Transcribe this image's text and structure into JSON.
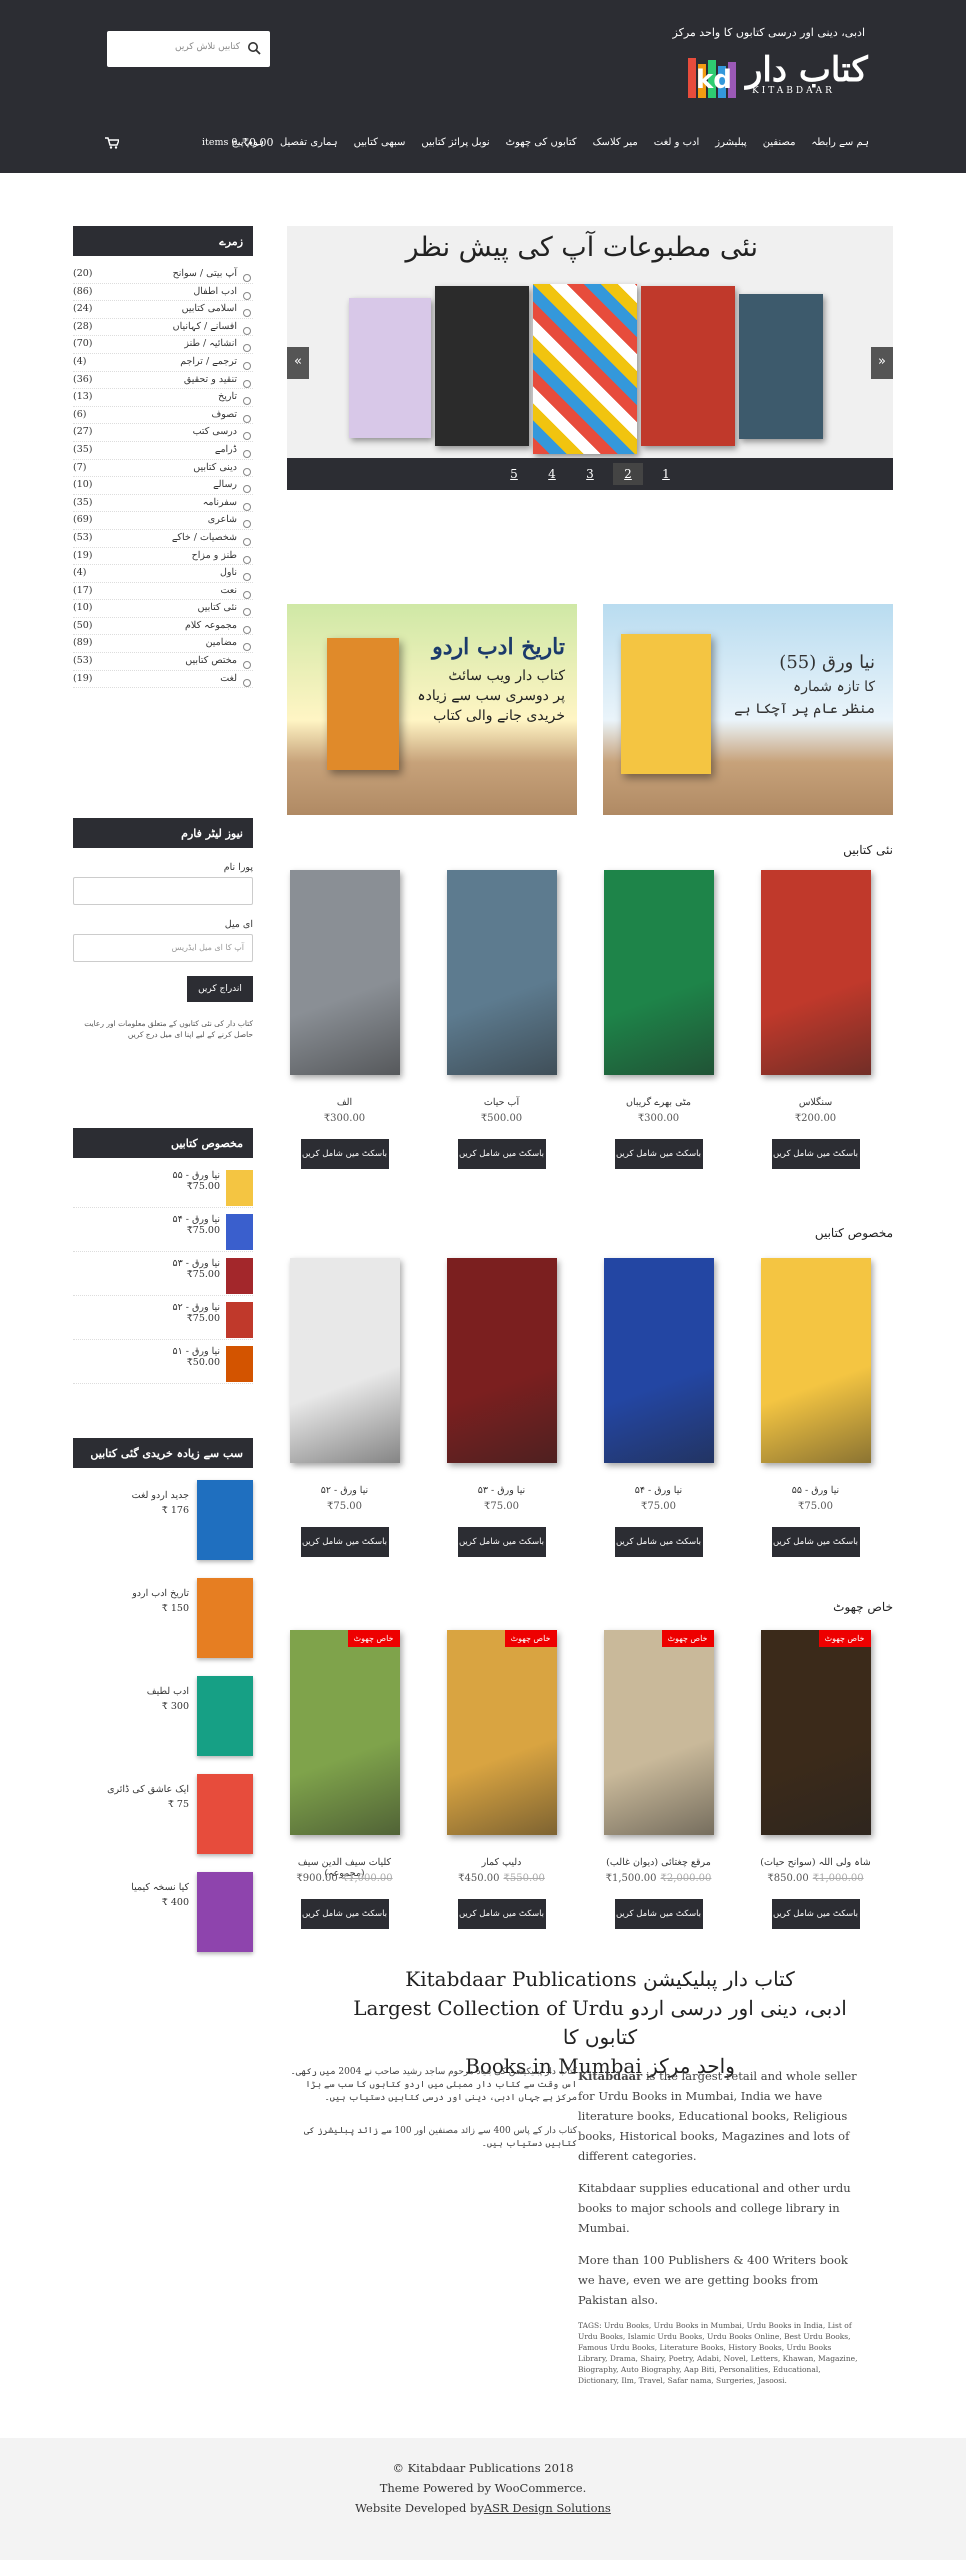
{
  "header": {
    "search_placeholder": "کتابیں تلاش کریں",
    "tagline": "ادبی، دینی اور درسی کتابوں کا واحد مرکز",
    "logo_word": "کتاب دار",
    "logo_latin": "KITABDAAR",
    "cart_items": "items 0",
    "cart_total": "₹0.00",
    "nav": [
      "ہوم پیج",
      "ہماری تفصیل",
      "سبھی کتابیں",
      "نوبل پرائز کتابیں",
      "کتابوں کی چھوٹ",
      "میر کلاسک",
      "ادب و لغت",
      "پبلیشرز",
      "مصنفین",
      "ہم سے رابطہ"
    ]
  },
  "sidebar": {
    "categories_title": "زمرے",
    "categories": [
      {
        "name": "آپ بیتی / سوانح",
        "count": "(20)"
      },
      {
        "name": "ادب اطفال",
        "count": "(86)"
      },
      {
        "name": "اسلامی کتابیں",
        "count": "(24)"
      },
      {
        "name": "افسانے / کہانیاں",
        "count": "(28)"
      },
      {
        "name": "انشائیہ / طنز",
        "count": "(70)"
      },
      {
        "name": "ترجمے / تراجم",
        "count": "(4)"
      },
      {
        "name": "تنقید و تحقیق",
        "count": "(36)"
      },
      {
        "name": "تاریخ",
        "count": "(13)"
      },
      {
        "name": "تصوف",
        "count": "(6)"
      },
      {
        "name": "درسی کتب",
        "count": "(27)"
      },
      {
        "name": "ڈرامے",
        "count": "(35)"
      },
      {
        "name": "دینی کتابیں",
        "count": "(7)"
      },
      {
        "name": "رسالے",
        "count": "(10)"
      },
      {
        "name": "سفرنامہ",
        "count": "(35)"
      },
      {
        "name": "شاعری",
        "count": "(69)"
      },
      {
        "name": "شخصیات / خاکے",
        "count": "(53)"
      },
      {
        "name": "طنز و مزاح",
        "count": "(19)"
      },
      {
        "name": "ناول",
        "count": "(4)"
      },
      {
        "name": "نعت",
        "count": "(17)"
      },
      {
        "name": "نئی کتابیں",
        "count": "(10)"
      },
      {
        "name": "مجموعہ کلام",
        "count": "(50)"
      },
      {
        "name": "مضامین",
        "count": "(89)"
      },
      {
        "name": "مختص کتابیں",
        "count": "(53)"
      },
      {
        "name": "لغت",
        "count": "(19)"
      }
    ],
    "newsletter_title": "نیوز لیٹر فارم",
    "name_label": "پورا نام",
    "email_label": "ای میل",
    "email_placeholder": "آپ کا ای میل ایڈریس",
    "subscribe_label": "اندراج کریں",
    "newsletter_note": "کتاب دار کی نئی کتابوں کے متعلق معلومات اور رعایت حاصل کرنے کے لیے اپنا ای میل درج کریں",
    "featured_title": "مخصوص کتابیں",
    "featured": [
      {
        "name": "نیا ورق - ۵۵",
        "price": "₹75.00",
        "color": "#f4c542"
      },
      {
        "name": "نیا ورق - ۵۴",
        "price": "₹75.00",
        "color": "#3a5fcd"
      },
      {
        "name": "نیا ورق - ۵۳",
        "price": "₹75.00",
        "color": "#a3272b"
      },
      {
        "name": "نیا ورق - ۵۲",
        "price": "₹75.00",
        "color": "#c0392b"
      },
      {
        "name": "نیا ورق - ۵۱",
        "price": "₹50.00",
        "color": "#d35400"
      }
    ],
    "bestseller_title": "سب سے زیادہ خریدی گئی کتابیں",
    "bestsellers": [
      {
        "name": "جدید اردو لغت",
        "price": "176 ₹",
        "color": "#1f6fbf"
      },
      {
        "name": "تاریخ ادب اردو",
        "price": "150 ₹",
        "color": "#e67e22"
      },
      {
        "name": "ادب لطیف",
        "price": "300 ₹",
        "color": "#16a085"
      },
      {
        "name": "ایک عاشق کی ڈائری",
        "price": "75 ₹",
        "color": "#e74c3c"
      },
      {
        "name": "کیا نسخہ کیمیا",
        "price": "400 ₹",
        "color": "#8e44ad"
      }
    ]
  },
  "slider": {
    "title": "نئی مطبوعات آپ کی پیش نظر",
    "prev": "«",
    "next": "»",
    "pages": [
      "5",
      "4",
      "3",
      "2",
      "1"
    ]
  },
  "banners": [
    {
      "line1": "تاریخ ادب اردو",
      "line2": "کتاب دار ویب سائٹ",
      "line3": "پر دوسری سب سے زیادہ",
      "line4": "خریدی جانے والی کتاب"
    },
    {
      "line1": "نیا ورق",
      "line2": "(55)",
      "line3": "کا تازہ شمارہ",
      "line4": "منظر عام پر آچکا ہے"
    }
  ],
  "sections": [
    {
      "title": "نئی کتابیں",
      "products": [
        {
          "name": "سنگلاس",
          "price": "₹200.00",
          "old": "",
          "sale": "",
          "color": "#c0392b"
        },
        {
          "name": "مٹی بھرے گریباں",
          "price": "₹300.00",
          "old": "",
          "sale": "",
          "color": "#1e8449"
        },
        {
          "name": "آب حیات",
          "price": "₹500.00",
          "old": "",
          "sale": "",
          "color": "#5d7b8f"
        },
        {
          "name": "الف",
          "price": "₹300.00",
          "old": "",
          "sale": "",
          "color": "#8a8f95"
        }
      ]
    },
    {
      "title": "مخصوص کتابیں",
      "products": [
        {
          "name": "نیا ورق - ۵۵",
          "price": "₹75.00",
          "old": "",
          "sale": "",
          "color": "#f4c542"
        },
        {
          "name": "نیا ورق - ۵۴",
          "price": "₹75.00",
          "old": "",
          "sale": "",
          "color": "#2346a3"
        },
        {
          "name": "نیا ورق - ۵۳",
          "price": "₹75.00",
          "old": "",
          "sale": "",
          "color": "#7b1f1f"
        },
        {
          "name": "نیا ورق - ۵۲",
          "price": "₹75.00",
          "old": "",
          "sale": "",
          "color": "#e8e8e8"
        }
      ]
    },
    {
      "title": "خاص چھوٹ",
      "products": [
        {
          "name": "شاہ ولی اللہ (سوانح حیات)",
          "price": "₹850.00",
          "old": "₹1,000.00",
          "sale": "خاص چھوٹ",
          "color": "#3b2a1a"
        },
        {
          "name": "مرقع چغتائی (دیوان غالب)",
          "price": "₹1,500.00",
          "old": "₹2,000.00",
          "sale": "خاص چھوٹ",
          "color": "#c9b99a"
        },
        {
          "name": "دلیپ کمار",
          "price": "₹450.00",
          "old": "₹550.00",
          "sale": "خاص چھوٹ",
          "color": "#d9a441"
        },
        {
          "name": "کلیات سیف الدین سیف (مجموعہ)",
          "price": "₹900.00",
          "old": "₹1,000.00",
          "sale": "خاص چھوٹ",
          "color": "#7fa34b"
        }
      ]
    }
  ],
  "add_to_cart": "باسکٹ میں شامل کریں",
  "about": {
    "heading_lines": [
      "Kitabdaar Publications کتاب دار پبلیکیشن",
      "Largest Collection of Urdu ادبی، دینی اور درسی اردو کتابوں کا",
      "Books in Mumbai واحد مرکز"
    ],
    "brand": "Kitabdaar",
    "en_p1": " is the largest retail and whole seller for Urdu Books in Mumbai, India we have literature books, Educational books, Religious books, Historical books, Magazines and lots of different categories.",
    "en_p2": "Kitabdaar supplies educational and other urdu books to major schools and college library in Mumbai.",
    "en_p3": "More than 100 Publishers & 400 Writers book we have, even we are getting books from Pakistan also.",
    "tags": "TAGS: Urdu Books, Urdu Books in Mumbai, Urdu Books in India, List of Urdu Books, Islamic Urdu Books, Urdu Books Online, Best Urdu Books, Famous Urdu Books, Literature Books, History Books, Urdu Books Library, Drama, Shairy, Poetry, Adabi, Novel, Letters, Khawan, Magazine, Biography, Auto Biography, Aap Biti, Personalities, Educational, Dictionary, Ilm, Travel, Safar nama, Surgeries, Jasoosi.",
    "ur_p1": "کتاب دار پبلیکیشن کی بنیاد مرحوم ساجد رشید صاحب نے 2004 میں رکھی۔ اس وقت سے کتاب دار ممبئی میں اردو کتابوں کا سب سے بڑا مرکز ہے جہاں ادبی، دینی اور درسی کتابیں دستیاب ہیں۔",
    "ur_p2": "کتاب دار کے پاس 400 سے زائد مصنفین اور 100 سے زائد پبلیشرز کی کتابیں دستیاب ہیں۔"
  },
  "footer": {
    "copyright": "© Kitabdaar Publications 2018",
    "powered": "Theme Powered by WooCommerce.",
    "dev_prefix": "Website Developed by",
    "dev_link": "ASR Design Solutions"
  }
}
